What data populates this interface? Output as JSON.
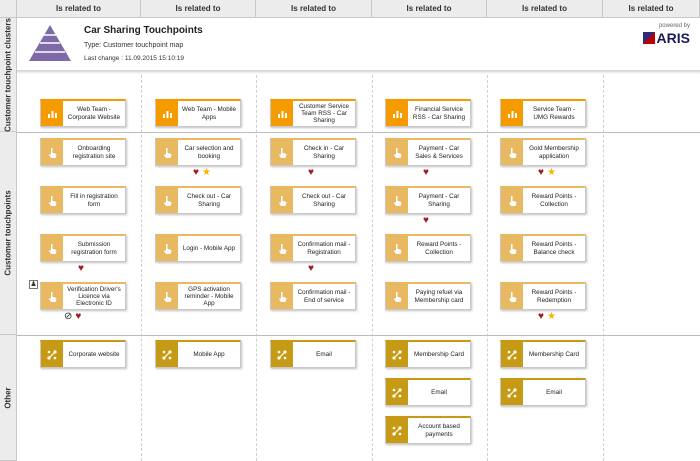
{
  "column_header": "Is related to",
  "rows": {
    "clusters": "Customer touchpoint clusters",
    "touchpoints": "Customer touchpoints",
    "other": "Other"
  },
  "title": {
    "name": "Car Sharing Touchpoints",
    "type": "Type: Customer touchpoint map",
    "last_change": "Last change : 11.09.2015 15:10:19"
  },
  "brand": {
    "powered_by": "powered by",
    "name": "ARIS"
  },
  "colors": {
    "team": "#f59b00",
    "touchpoint": "#e8b961",
    "channel": "#c79a16",
    "heart": "#a3192b",
    "star": "#f2b400"
  },
  "columns": [
    {
      "team": "Web Team - Corporate Website",
      "touchpoints": [
        {
          "label": "Onboarding registration site",
          "marks": []
        },
        {
          "label": "Fill in registration form",
          "marks": []
        },
        {
          "label": "Submission registration form",
          "marks": [
            "heart"
          ]
        },
        {
          "label": "Verification Driver's Licence via Electronic ID",
          "marks": [
            "noentry",
            "heart"
          ]
        }
      ],
      "channels": [
        "Corporate website"
      ]
    },
    {
      "team": "Web Team - Mobile Apps",
      "touchpoints": [
        {
          "label": "Car selection and booking",
          "marks": [
            "heart",
            "star"
          ]
        },
        {
          "label": "Check out - Car Sharing",
          "marks": []
        },
        {
          "label": "Login - Mobile App",
          "marks": []
        },
        {
          "label": "GPS activation reminder - Mobile App",
          "marks": []
        }
      ],
      "channels": [
        "Mobile App"
      ]
    },
    {
      "team": "Customer Service Team RSS - Car Sharing",
      "touchpoints": [
        {
          "label": "Check in - Car Sharing",
          "marks": [
            "heart"
          ]
        },
        {
          "label": "Check out - Car Sharing",
          "marks": []
        },
        {
          "label": "Confirmation mail - Registration",
          "marks": [
            "heart"
          ]
        },
        {
          "label": "Confirmation mail - End of service",
          "marks": []
        }
      ],
      "channels": [
        "Email"
      ]
    },
    {
      "team": "Financial Service RSS - Car Sharing",
      "touchpoints": [
        {
          "label": "Payment - Car Sales & Services",
          "marks": [
            "heart"
          ]
        },
        {
          "label": "Payment - Car Sharing",
          "marks": [
            "heart"
          ]
        },
        {
          "label": "Reward Points - Collection",
          "marks": []
        },
        {
          "label": "Paying refuel via Membership card",
          "marks": []
        }
      ],
      "channels": [
        "Membership Card",
        "Email",
        "Account based payments"
      ]
    },
    {
      "team": "Service Team - UMG Rewards",
      "touchpoints": [
        {
          "label": "Gold Membership application",
          "marks": [
            "heart",
            "star"
          ]
        },
        {
          "label": "Reward Points - Collection",
          "marks": []
        },
        {
          "label": "Reward Points - Balance check",
          "marks": []
        },
        {
          "label": "Reward Points - Redemption",
          "marks": [
            "heart",
            "star"
          ]
        }
      ],
      "channels": [
        "Membership Card",
        "Email"
      ]
    }
  ]
}
